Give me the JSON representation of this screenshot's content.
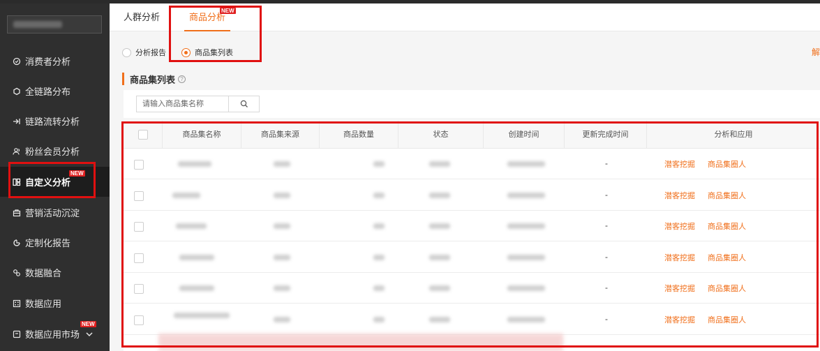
{
  "sidebar": {
    "items": [
      {
        "label": "消费者分析",
        "icon": "check-circle-icon"
      },
      {
        "label": "全链路分布",
        "icon": "hexagon-icon"
      },
      {
        "label": "链路流转分析",
        "icon": "flow-icon"
      },
      {
        "label": "粉丝会员分析",
        "icon": "users-icon"
      },
      {
        "label": "自定义分析",
        "icon": "grid-icon",
        "badge": "NEW"
      },
      {
        "label": "营销活动沉淀",
        "icon": "briefcase-icon"
      },
      {
        "label": "定制化报告",
        "icon": "report-icon"
      },
      {
        "label": "数据融合",
        "icon": "merge-icon"
      },
      {
        "label": "数据应用",
        "icon": "dice-icon"
      },
      {
        "label": "数据应用市场",
        "icon": "market-icon",
        "badge": "NEW"
      }
    ]
  },
  "tabs": [
    {
      "label": "人群分析"
    },
    {
      "label": "商品分析",
      "badge": "NEW"
    }
  ],
  "radios": [
    {
      "label": "分析报告"
    },
    {
      "label": "商品集列表"
    }
  ],
  "right_link": "解",
  "section": {
    "title": "商品集列表",
    "help": "?"
  },
  "search": {
    "placeholder": "请输入商品集名称"
  },
  "table": {
    "headers": [
      "商品集名称",
      "商品集来源",
      "商品数量",
      "状态",
      "创建时间",
      "更新完成时间",
      "分析和应用"
    ],
    "rows": [
      {
        "updated": "-",
        "action1": "潜客挖掘",
        "action2": "商品集圈人"
      },
      {
        "updated": "-",
        "action1": "潜客挖掘",
        "action2": "商品集圈人"
      },
      {
        "updated": "-",
        "action1": "潜客挖掘",
        "action2": "商品集圈人"
      },
      {
        "updated": "-",
        "action1": "潜客挖掘",
        "action2": "商品集圈人"
      },
      {
        "updated": "-",
        "action1": "潜客挖掘",
        "action2": "商品集圈人"
      },
      {
        "updated": "-",
        "action1": "潜客挖掘",
        "action2": "商品集圈人"
      }
    ]
  },
  "colors": {
    "accent": "#f06f1b",
    "sidebar_bg": "#2f2f2f",
    "highlight_border": "#e01010",
    "badge": "#e02020"
  }
}
